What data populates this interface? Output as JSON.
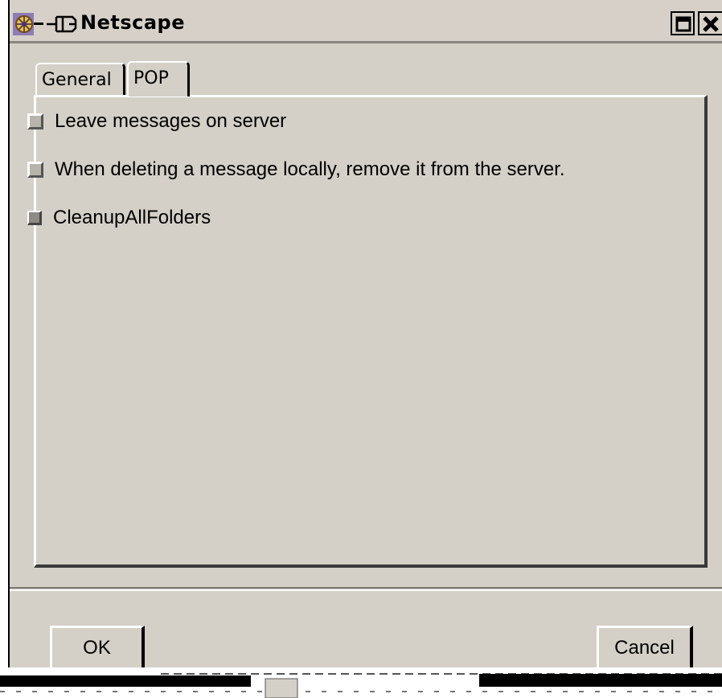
{
  "window": {
    "title": "Netscape"
  },
  "titlebar": {
    "logo_icon": "netscape-logo",
    "pin_icon": "pin-icon",
    "maximize_icon": "maximize-icon",
    "close_icon": "close-icon"
  },
  "tabs": [
    {
      "label": "General",
      "selected": false
    },
    {
      "label": "POP",
      "selected": true
    }
  ],
  "options": [
    {
      "label": "Leave messages on server",
      "checked": false
    },
    {
      "label": "When deleting a message locally, remove it from the server.",
      "checked": false
    },
    {
      "label": "CleanupAllFolders",
      "checked": false
    }
  ],
  "buttons": {
    "ok_label": "OK",
    "cancel_label": "Cancel"
  },
  "colors": {
    "background": "#d4cfc7",
    "text": "#000000",
    "highlight": "#ffffff",
    "shadow": "#3a3a3a"
  }
}
